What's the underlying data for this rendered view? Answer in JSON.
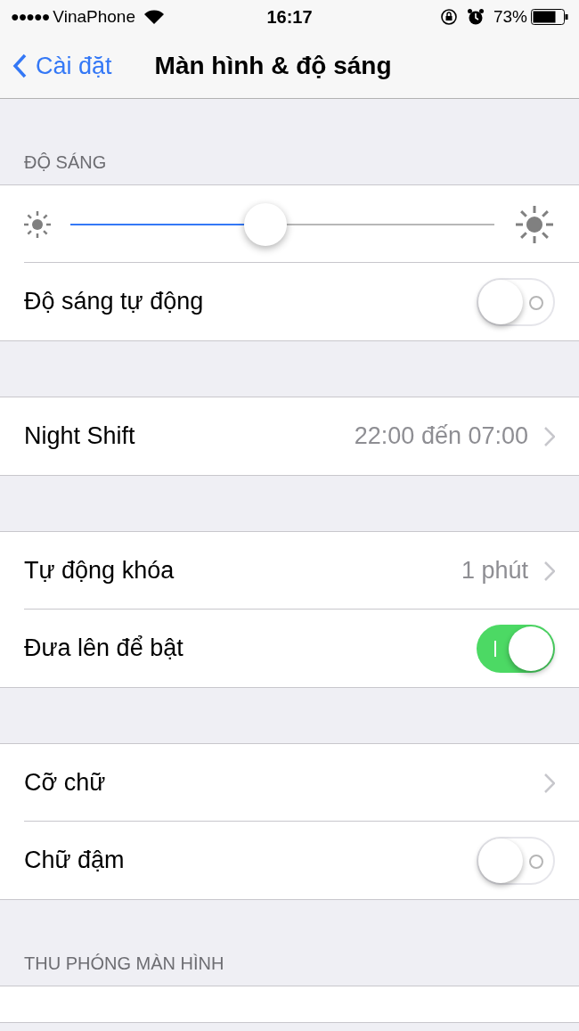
{
  "status_bar": {
    "signal": "●●●●●",
    "carrier": "VinaPhone",
    "time": "16:17",
    "battery": "73%"
  },
  "nav": {
    "back": "Cài đặt",
    "title": "Màn hình & độ sáng"
  },
  "sections": [
    {
      "header": "ĐỘ SÁNG",
      "rows": [
        {
          "kind": "slider",
          "level": 0.46
        },
        {
          "kind": "toggle",
          "label": "Độ sáng tự động",
          "on": false
        }
      ]
    },
    {
      "rows": [
        {
          "kind": "link",
          "label": "Night Shift",
          "value": "22:00 đến 07:00"
        }
      ]
    },
    {
      "rows": [
        {
          "kind": "link",
          "label": "Tự động khóa",
          "value": "1 phút"
        },
        {
          "kind": "toggle",
          "label": "Đưa lên để bật",
          "on": true
        }
      ]
    },
    {
      "rows": [
        {
          "kind": "link",
          "label": "Cỡ chữ"
        },
        {
          "kind": "toggle",
          "label": "Chữ đậm",
          "on": false
        }
      ]
    },
    {
      "header": "THU PHÓNG MÀN HÌNH",
      "rows": [
        {
          "kind": "cut"
        }
      ]
    }
  ]
}
